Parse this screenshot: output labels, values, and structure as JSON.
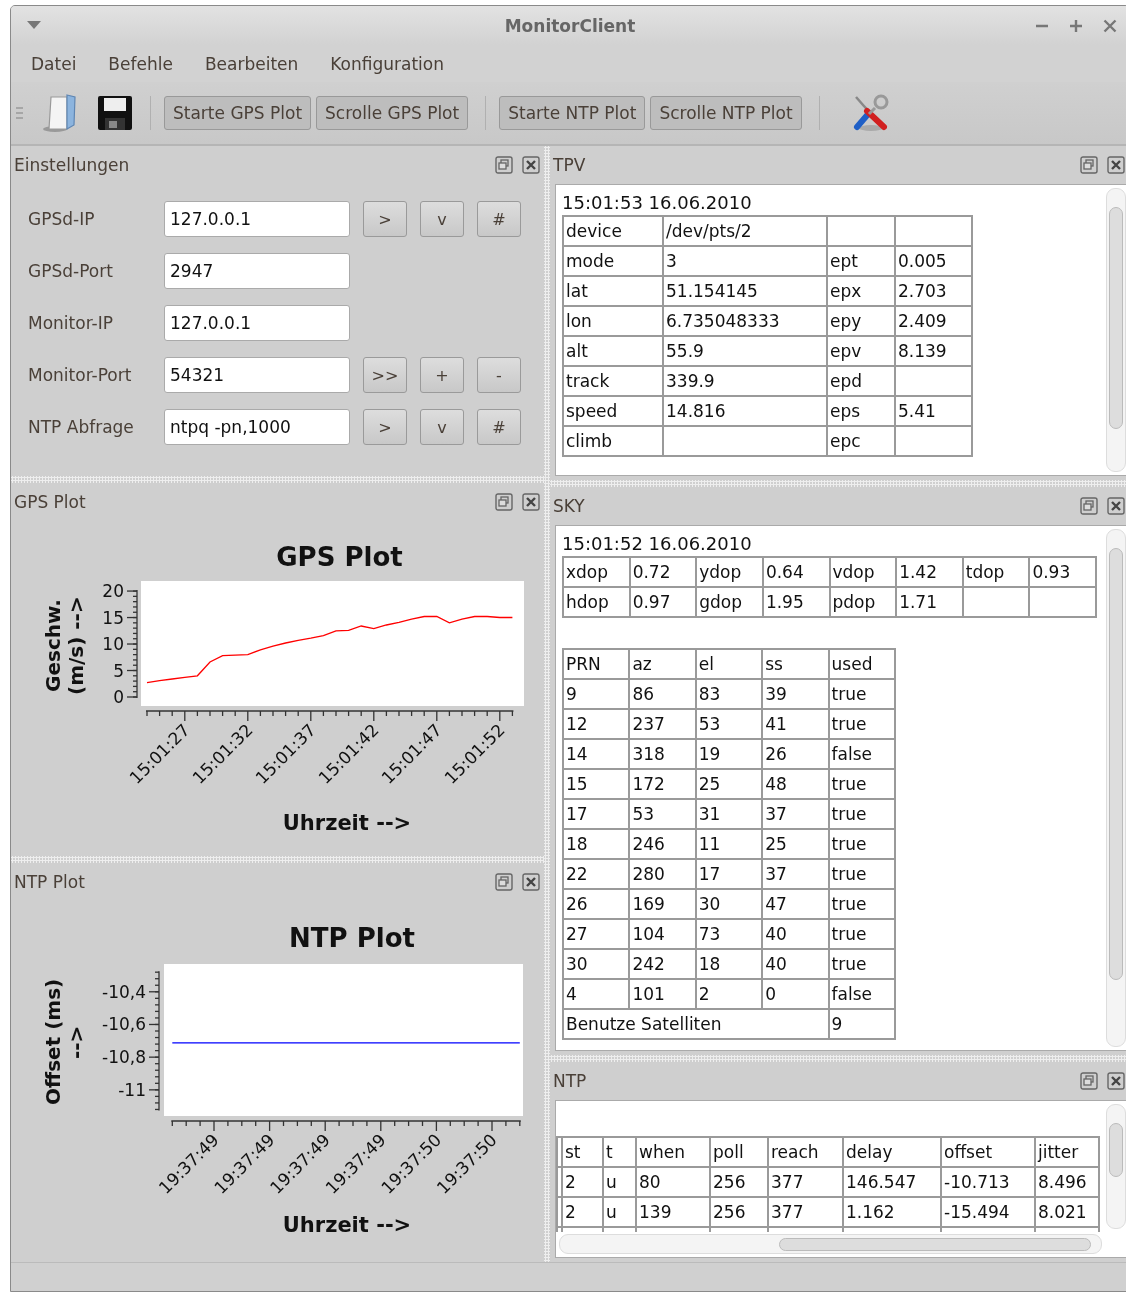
{
  "window": {
    "title": "MonitorClient"
  },
  "menu": [
    "Datei",
    "Befehle",
    "Bearbeiten",
    "Konfiguration"
  ],
  "toolbar": {
    "groups": [
      [
        "Starte GPS Plot",
        "Scrolle GPS Plot"
      ],
      [
        "Starte NTP Plot",
        "Scrolle NTP Plot"
      ]
    ]
  },
  "settings": {
    "title": "Einstellungen",
    "rows": [
      {
        "label": "GPSd-IP",
        "value": "127.0.0.1",
        "buttons": [
          ">",
          "v",
          "#"
        ]
      },
      {
        "label": "GPSd-Port",
        "value": "2947"
      },
      {
        "label": "Monitor-IP",
        "value": "127.0.0.1"
      },
      {
        "label": "Monitor-Port",
        "value": "54321",
        "buttons": [
          ">>",
          "+",
          "-"
        ]
      },
      {
        "label": "NTP Abfrage",
        "value": "ntpq -pn,1000",
        "buttons": [
          ">",
          "v",
          "#"
        ]
      }
    ]
  },
  "gps_plot": {
    "title": "GPS Plot",
    "chart_data": {
      "type": "line",
      "title": "GPS Plot",
      "xlabel": "Uhrzeit -->",
      "ylabel": "Geschw. (m/s) -->",
      "categories": [
        null,
        null,
        null,
        "15:01:27",
        null,
        null,
        null,
        null,
        "15:01:32",
        null,
        null,
        null,
        null,
        "15:01:37",
        null,
        null,
        null,
        null,
        "15:01:42",
        null,
        null,
        null,
        null,
        "15:01:47",
        null,
        null,
        null,
        null,
        "15:01:52",
        null
      ],
      "series": [
        {
          "color": "#ff0000",
          "values": [
            2.7,
            3.1,
            3.4,
            3.7,
            4.0,
            6.6,
            7.8,
            7.9,
            8.0,
            8.9,
            9.6,
            10.2,
            10.7,
            11.1,
            11.6,
            12.5,
            12.6,
            13.4,
            12.9,
            13.6,
            14.1,
            14.7,
            15.2,
            15.2,
            14.0,
            14.7,
            15.2,
            15.2,
            15.0,
            15.0
          ]
        }
      ],
      "ylim": [
        -1.7,
        21.9
      ],
      "yticks": [
        0,
        5,
        10,
        15,
        20
      ]
    }
  },
  "ntp_plot": {
    "title": "NTP Plot",
    "chart_data": {
      "type": "line",
      "title": "NTP Plot",
      "xlabel": "Uhrzeit -->",
      "ylabel": "Offset (ms) -->",
      "categories": [
        null,
        null,
        null,
        "19:37:49",
        null,
        null,
        null,
        "19:37:49",
        null,
        null,
        null,
        "19:37:49",
        null,
        null,
        null,
        "19:37:49",
        null,
        null,
        null,
        "19:37:50",
        null,
        null,
        null,
        "19:37:50",
        null,
        null
      ],
      "series": [
        {
          "color": "#0000ff",
          "values": [
            -10.713,
            -10.713,
            -10.713,
            -10.713,
            -10.713,
            -10.713,
            -10.713,
            -10.713,
            -10.713,
            -10.713,
            -10.713,
            -10.713,
            -10.713,
            -10.713,
            -10.713,
            -10.713,
            -10.713,
            -10.713,
            -10.713,
            -10.713,
            -10.713,
            -10.713,
            -10.713,
            -10.713,
            -10.713,
            -10.713
          ]
        }
      ],
      "ylim": [
        -11.16,
        -10.23
      ],
      "yticks": [
        {
          "value": -10.4,
          "label": "-10,4"
        },
        {
          "value": -10.6,
          "label": "-10,6"
        },
        {
          "value": -10.8,
          "label": "-10,8"
        },
        {
          "value": -11,
          "label": "-11"
        }
      ]
    }
  },
  "tpv": {
    "title": "TPV",
    "timestamp": "15:01:53 16.06.2010",
    "rows": [
      {
        "field": "device",
        "value": "/dev/pts/2"
      },
      {
        "field": "mode",
        "value": "3",
        "error_field": "ept",
        "error": "0.005"
      },
      {
        "field": "lat",
        "value": "51.154145",
        "error_field": "epx",
        "error": "2.703"
      },
      {
        "field": "lon",
        "value": "6.735048333",
        "error_field": "epy",
        "error": "2.409"
      },
      {
        "field": "alt",
        "value": "55.9",
        "error_field": "epv",
        "error": "8.139"
      },
      {
        "field": "track",
        "value": "339.9",
        "error_field": "epd"
      },
      {
        "field": "speed",
        "value": "14.816",
        "error_field": "eps",
        "error": "5.41"
      },
      {
        "field": "climb",
        "error_field": "epc"
      }
    ]
  },
  "sky": {
    "title": "SKY",
    "timestamp": "15:01:52 16.06.2010",
    "dop": [
      [
        {
          "name": "xdop",
          "value": "0.72"
        },
        {
          "name": "ydop",
          "value": "0.64"
        },
        {
          "name": "vdop",
          "value": "1.42"
        },
        {
          "name": "tdop",
          "value": "0.93"
        }
      ],
      [
        {
          "name": "hdop",
          "value": "0.97"
        },
        {
          "name": "gdop",
          "value": "1.95"
        },
        {
          "name": "pdop",
          "value": "1.71"
        }
      ]
    ],
    "columns": [
      "PRN",
      "az",
      "el",
      "ss",
      "used"
    ],
    "satellites": [
      [
        "9",
        "86",
        "83",
        "39",
        "true"
      ],
      [
        "12",
        "237",
        "53",
        "41",
        "true"
      ],
      [
        "14",
        "318",
        "19",
        "26",
        "false"
      ],
      [
        "15",
        "172",
        "25",
        "48",
        "true"
      ],
      [
        "17",
        "53",
        "31",
        "37",
        "true"
      ],
      [
        "18",
        "246",
        "11",
        "25",
        "true"
      ],
      [
        "22",
        "280",
        "17",
        "37",
        "true"
      ],
      [
        "26",
        "169",
        "30",
        "47",
        "true"
      ],
      [
        "27",
        "104",
        "73",
        "40",
        "true"
      ],
      [
        "30",
        "242",
        "18",
        "40",
        "true"
      ],
      [
        "4",
        "101",
        "2",
        "0",
        "false"
      ]
    ],
    "footer": {
      "label": "Benutze Satelliten",
      "value": "9"
    }
  },
  "ntp": {
    "title": "NTP",
    "columns": [
      "st",
      "t",
      "when",
      "poll",
      "reach",
      "delay",
      "offset",
      "jitter"
    ],
    "rows": [
      [
        "2",
        "u",
        "80",
        "256",
        "377",
        "146.547",
        "-10.713",
        "8.496"
      ],
      [
        "2",
        "u",
        "139",
        "256",
        "377",
        "1.162",
        "-15.494",
        "8.021"
      ]
    ]
  }
}
